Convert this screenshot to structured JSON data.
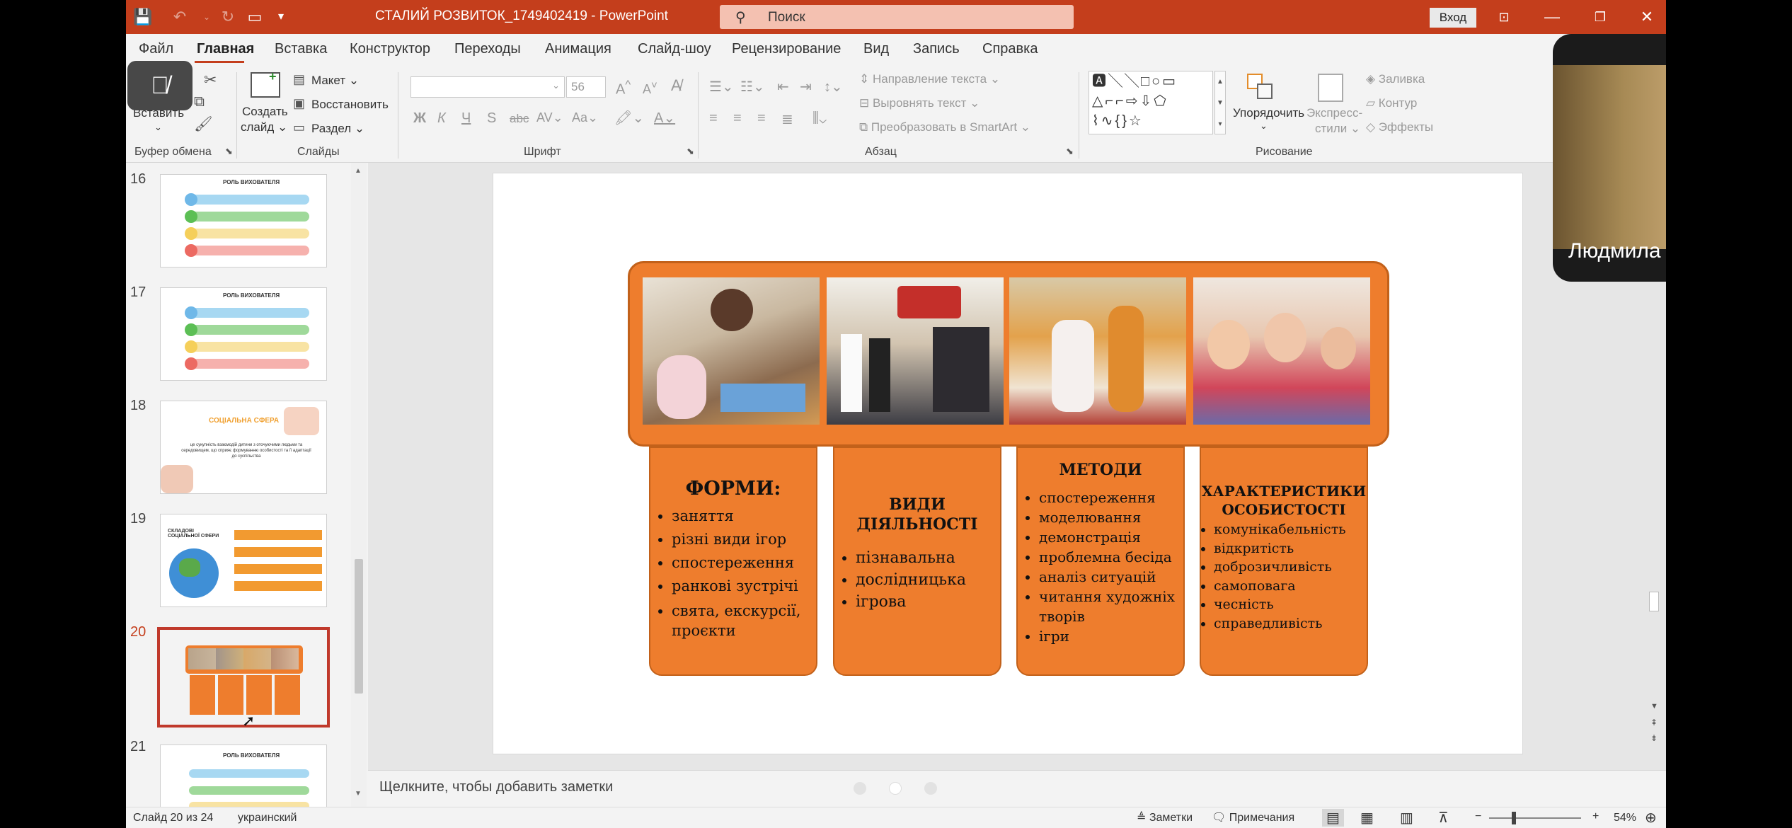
{
  "title_bar": {
    "doc_title": "СТАЛИЙ РОЗВИТОК_1749402419",
    "separator": "-",
    "app_name": "PowerPoint",
    "search_placeholder": "Поиск",
    "login_label": "Вход"
  },
  "tabs": [
    "Файл",
    "Главная",
    "Вставка",
    "Конструктор",
    "Переходы",
    "Анимация",
    "Слайд-шоу",
    "Рецензирование",
    "Вид",
    "Запись",
    "Справка"
  ],
  "ribbon": {
    "clipboard": {
      "paste": "Вставить",
      "group": "Буфер обмена"
    },
    "slides": {
      "new_slide_1": "Создать",
      "new_slide_2": "слайд",
      "layout": "Макет",
      "reset": "Восстановить",
      "section": "Раздел",
      "group": "Слайды"
    },
    "font": {
      "font_size": "56",
      "bold": "Ж",
      "italic": "К",
      "underline": "Ч",
      "shadow": "S",
      "strike": "abc",
      "group": "Шрифт"
    },
    "paragraph": {
      "text_direction": "Направление текста",
      "align_text": "Выровнять текст",
      "smartart": "Преобразовать в SmartArt",
      "group": "Абзац"
    },
    "drawing": {
      "arrange": "Упорядочить",
      "quick_styles_1": "Экспресс-",
      "quick_styles_2": "стили",
      "fill": "Заливка",
      "outline": "Контур",
      "effects": "Эффекты",
      "group": "Рисование"
    }
  },
  "thumbnails": [
    {
      "num": "16",
      "title": "РОЛЬ ВИХОВАТЕЛЯ"
    },
    {
      "num": "17",
      "title": "РОЛЬ ВИХОВАТЕЛЯ"
    },
    {
      "num": "18",
      "title": "СОЦІАЛЬНА СФЕРА",
      "text": "це сукупність взаємодій дитини з оточуючими людьми та середовищем, що сприяє формуванню особистості та її адаптації до суспільства"
    },
    {
      "num": "19",
      "title": "СКЛАДОВІ СОЦІАЛЬНОЇ СФЕРИ"
    },
    {
      "num": "20"
    },
    {
      "num": "21",
      "title": "РОЛЬ ВИХОВАТЕЛЯ"
    }
  ],
  "slide": {
    "cards": [
      {
        "title": "ФОРМИ:",
        "items": [
          "заняття",
          "різні види ігор",
          "спостереження",
          "ранкові зустрічі",
          "свята, екскурсії, проєкти"
        ]
      },
      {
        "title": "ВИДИ ДІЯЛЬНОСТІ",
        "items": [
          "пізнавальна",
          "дослідницька",
          "ігрова"
        ]
      },
      {
        "title": "МЕТОДИ",
        "items": [
          "спостереження",
          "моделювання",
          "демонстрація",
          "проблемна бесіда",
          "аналіз ситуацій",
          "читання художніх творів",
          "ігри"
        ]
      },
      {
        "title": "ХАРАКТЕРИСТИКИ ОСОБИСТОСТІ",
        "items": [
          "комунікабельність",
          "відкритість",
          "доброзичливість",
          "самоповага",
          "чесність",
          "справедливість"
        ]
      }
    ]
  },
  "notes_placeholder": "Щелкните, чтобы добавить заметки",
  "status_bar": {
    "slide_info": "Слайд 20 из 24",
    "language": "украинский",
    "notes": "Заметки",
    "comments": "Примечания",
    "zoom": "54%",
    "zoom_minus": "−",
    "zoom_plus": "+"
  },
  "video": {
    "participant_name": "Людмила Мацук"
  },
  "colors": {
    "accent": "#c43e1c",
    "slide_orange": "#ee7d2d",
    "selection": "#c0392b"
  }
}
